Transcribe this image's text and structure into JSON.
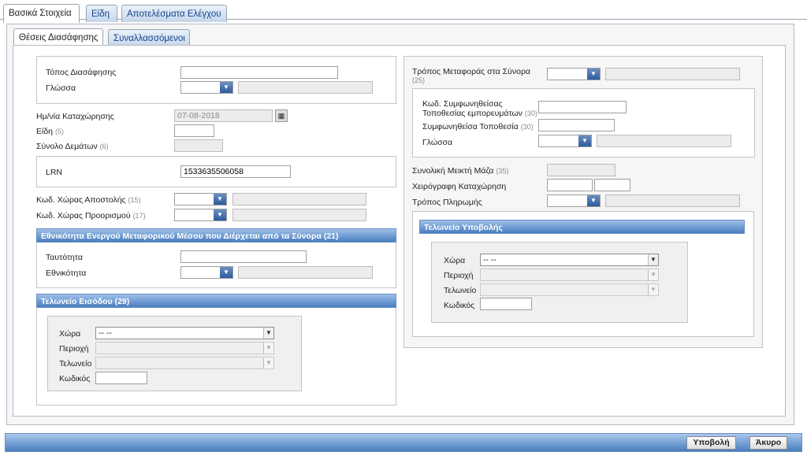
{
  "tabs_main": [
    "Βασικά Στοιχεία",
    "Είδη",
    "Αποτελέσματα Ελέγχου"
  ],
  "tabs_sub": [
    "Θέσεις Διασάφησης",
    "Συναλλασσόμενοι"
  ],
  "left": {
    "topos_label": "Τόπος Διασάφησης",
    "topos_value": "",
    "glossa_label": "Γλώσσα",
    "date_label": "Ημ/νία Καταχώρησης",
    "date_value": "07-08-2018",
    "eidi_label": "Είδη",
    "eidi_num": "(5)",
    "synolo_label": "Σύνολο Δεμάτων",
    "synolo_num": "(6)",
    "lrn_label": "LRN",
    "lrn_value": "1533635506058",
    "apostolis_label": "Κωδ. Χώρας Αποστολής",
    "apostolis_num": "(15)",
    "proorismou_label": "Κωδ. Χώρας Προορισμού",
    "proorismou_num": "(17)",
    "ethnikotita_title": "Εθνικότητα Ενεργού Μεταφορικού Μέσου που Διέρχεται από τα Σύνορα (21)",
    "tautotita_label": "Ταυτότητα",
    "ethnikotita_label": "Εθνικότητα",
    "eisodou_title": "Τελωνείο Εισόδου (29)",
    "xora_label": "Χώρα",
    "xora_value": "-- --",
    "perioxi_label": "Περιοχή",
    "teloneio_label": "Τελωνείο",
    "kodikos_label": "Κωδικός"
  },
  "right": {
    "metaforas_label": "Τρόπος Μεταφοράς στα Σύνορα",
    "metaforas_num": "(25)",
    "symf_label1": "Κωδ. Συμφωνηθείσας",
    "symf_label2": "Τοποθεσίας εμπορευμάτων",
    "symf_num": "(30)",
    "symf_top_label": "Συμφωνηθείσα Τοποθεσία",
    "symf_top_num": "(30)",
    "glossa_label": "Γλώσσα",
    "mikti_label": "Συνολική Μεικτή Μάζα",
    "mikti_num": "(35)",
    "xeirografi_label": "Χειρόγραφη Καταχώρηση",
    "pliromi_label": "Τρόπος Πληρωμής",
    "ypovolis_title": "Τελωνείο Υποβολής",
    "xora_label": "Χώρα",
    "xora_value": "-- --",
    "perioxi_label": "Περιοχή",
    "teloneio_label": "Τελωνείο",
    "kodikos_label": "Κωδικός"
  },
  "footer": {
    "submit": "Υποβολή",
    "cancel": "Άκυρο"
  },
  "colors": {
    "accent": "#4a7ebf",
    "tab_text": "#15428b"
  }
}
